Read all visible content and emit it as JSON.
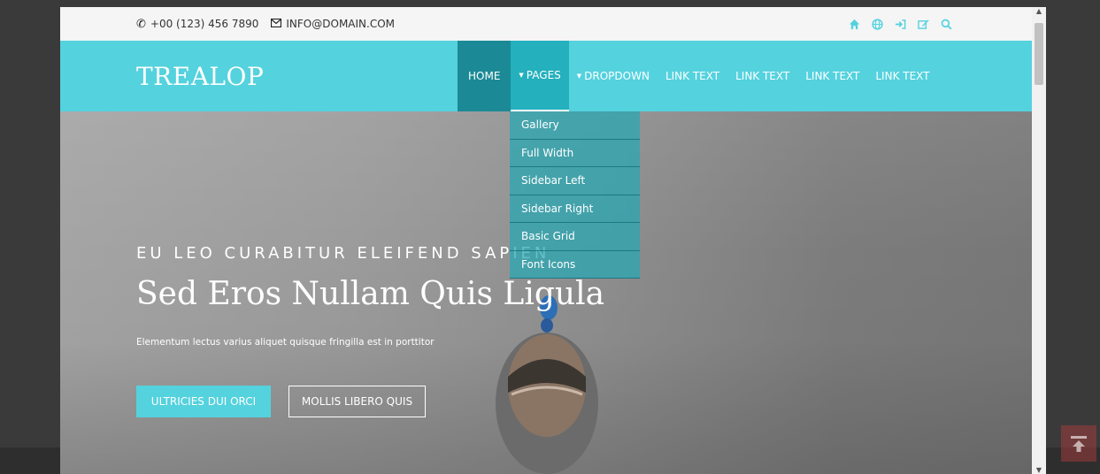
{
  "topbar": {
    "phone": "+00 (123) 456 7890",
    "email": "INFO@DOMAIN.COM",
    "icons": [
      "home-icon",
      "globe-icon",
      "sign-in-icon",
      "edit-icon",
      "search-icon"
    ],
    "icon_color": "#54d2de"
  },
  "header": {
    "logo": "TREALOP",
    "background": "#54d2de",
    "nav": {
      "home": "HOME",
      "pages": "PAGES",
      "dropdown": "DROPDOWN",
      "link1": "LINK TEXT",
      "link2": "LINK TEXT",
      "link3": "LINK TEXT",
      "link4": "LINK TEXT"
    }
  },
  "dropdown_menu": [
    "Gallery",
    "Full Width",
    "Sidebar Left",
    "Sidebar Right",
    "Basic Grid",
    "Font Icons"
  ],
  "hero": {
    "eyebrow": "EU LEO CURABITUR ELEIFEND SAPIEN",
    "title": "Sed Eros Nullam Quis Ligula",
    "subtitle": "Elementum lectus varius aliquet quisque fringilla est in porttitor",
    "primary_button": "ULTRICIES DUI ORCI",
    "secondary_button": "MOLLIS LIBERO QUIS"
  }
}
